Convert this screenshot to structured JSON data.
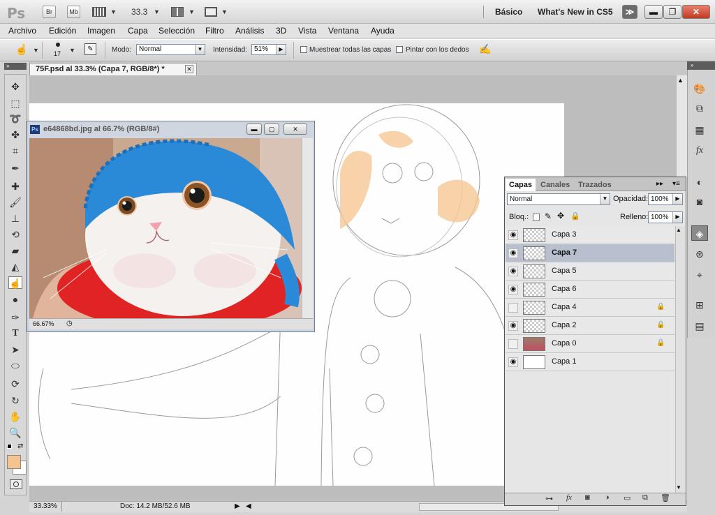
{
  "app": {
    "logo": "Ps",
    "bridge_label": "Br",
    "minibridge_label": "Mb",
    "zoom": "33.3",
    "workspace": "Básico",
    "whats_new": "What's New in CS5",
    "overflow": "≫"
  },
  "menu": [
    "Archivo",
    "Edición",
    "Imagen",
    "Capa",
    "Selección",
    "Filtro",
    "Análisis",
    "3D",
    "Vista",
    "Ventana",
    "Ayuda"
  ],
  "options": {
    "brush_size": "17",
    "mode_label": "Modo:",
    "mode_value": "Normal",
    "strength_label": "Intensidad:",
    "strength_value": "51%",
    "sample_all": "Muestrear todas las capas",
    "finger_paint": "Pintar con los dedos"
  },
  "document": {
    "tab_title": "75F.psd al 33.3% (Capa 7, RGB/8*) *",
    "status_zoom": "33.33%",
    "status_doc": "Doc: 14.2 MB/52.6 MB"
  },
  "image_window": {
    "title": "e64868bd.jpg al 66.7% (RGB/8#)",
    "zoom": "66.67%"
  },
  "layers_panel": {
    "tabs": [
      "Capas",
      "Canales",
      "Trazados"
    ],
    "blend_mode": "Normal",
    "opacity_label": "Opacidad:",
    "opacity_value": "100%",
    "lock_label": "Bloq.:",
    "fill_label": "Relleno:",
    "fill_value": "100%",
    "layers": [
      {
        "name": "Capa 3",
        "visible": true,
        "locked": false,
        "thumb": "transparent"
      },
      {
        "name": "Capa 7",
        "visible": true,
        "locked": false,
        "thumb": "transparent",
        "selected": true
      },
      {
        "name": "Capa 5",
        "visible": true,
        "locked": false,
        "thumb": "transparent"
      },
      {
        "name": "Capa 6",
        "visible": true,
        "locked": false,
        "thumb": "transparent"
      },
      {
        "name": "Capa 4",
        "visible": false,
        "locked": true,
        "thumb": "transparent"
      },
      {
        "name": "Capa 2",
        "visible": true,
        "locked": true,
        "thumb": "transparent"
      },
      {
        "name": "Capa 0",
        "visible": false,
        "locked": true,
        "thumb": "photo"
      },
      {
        "name": "Capa 1",
        "visible": true,
        "locked": false,
        "thumb": "white"
      }
    ]
  },
  "colors": {
    "foreground": "#f5c48e",
    "background": "#ffffff",
    "selected_layer": "#b8c0cf",
    "hat_blue": "#2a8ad8",
    "scarf_red": "#e02424"
  },
  "icons": {
    "eye": "eye-icon",
    "lock": "lock-icon"
  }
}
